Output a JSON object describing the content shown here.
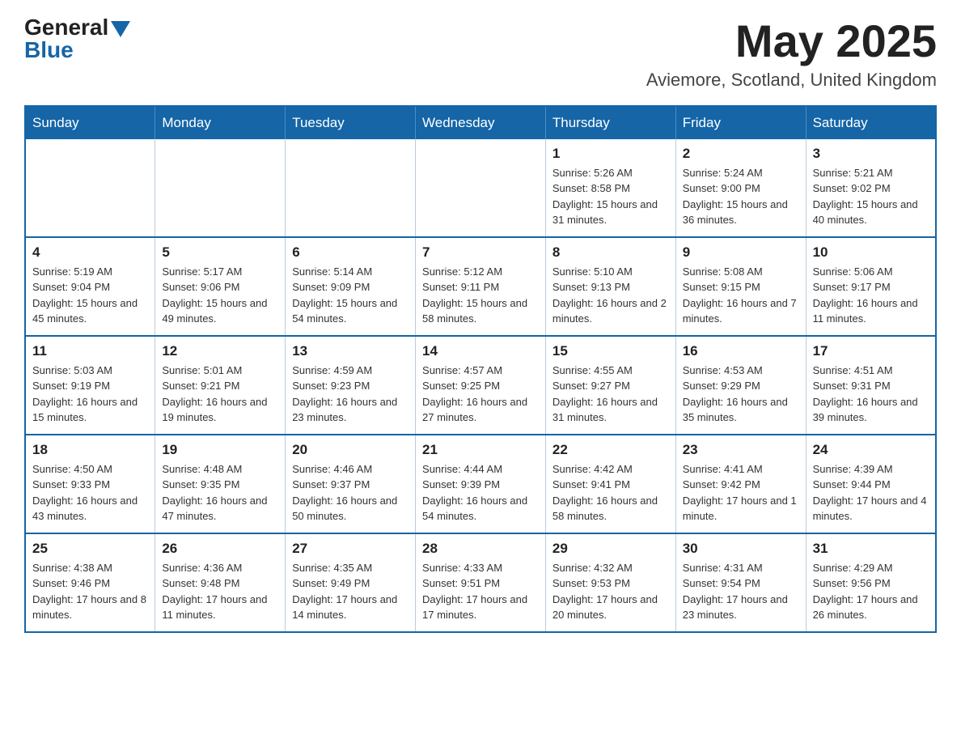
{
  "logo": {
    "general": "General",
    "blue": "Blue"
  },
  "title": {
    "month_year": "May 2025",
    "location": "Aviemore, Scotland, United Kingdom"
  },
  "weekdays": [
    "Sunday",
    "Monday",
    "Tuesday",
    "Wednesday",
    "Thursday",
    "Friday",
    "Saturday"
  ],
  "weeks": [
    [
      {
        "day": "",
        "info": ""
      },
      {
        "day": "",
        "info": ""
      },
      {
        "day": "",
        "info": ""
      },
      {
        "day": "",
        "info": ""
      },
      {
        "day": "1",
        "info": "Sunrise: 5:26 AM\nSunset: 8:58 PM\nDaylight: 15 hours and 31 minutes."
      },
      {
        "day": "2",
        "info": "Sunrise: 5:24 AM\nSunset: 9:00 PM\nDaylight: 15 hours and 36 minutes."
      },
      {
        "day": "3",
        "info": "Sunrise: 5:21 AM\nSunset: 9:02 PM\nDaylight: 15 hours and 40 minutes."
      }
    ],
    [
      {
        "day": "4",
        "info": "Sunrise: 5:19 AM\nSunset: 9:04 PM\nDaylight: 15 hours and 45 minutes."
      },
      {
        "day": "5",
        "info": "Sunrise: 5:17 AM\nSunset: 9:06 PM\nDaylight: 15 hours and 49 minutes."
      },
      {
        "day": "6",
        "info": "Sunrise: 5:14 AM\nSunset: 9:09 PM\nDaylight: 15 hours and 54 minutes."
      },
      {
        "day": "7",
        "info": "Sunrise: 5:12 AM\nSunset: 9:11 PM\nDaylight: 15 hours and 58 minutes."
      },
      {
        "day": "8",
        "info": "Sunrise: 5:10 AM\nSunset: 9:13 PM\nDaylight: 16 hours and 2 minutes."
      },
      {
        "day": "9",
        "info": "Sunrise: 5:08 AM\nSunset: 9:15 PM\nDaylight: 16 hours and 7 minutes."
      },
      {
        "day": "10",
        "info": "Sunrise: 5:06 AM\nSunset: 9:17 PM\nDaylight: 16 hours and 11 minutes."
      }
    ],
    [
      {
        "day": "11",
        "info": "Sunrise: 5:03 AM\nSunset: 9:19 PM\nDaylight: 16 hours and 15 minutes."
      },
      {
        "day": "12",
        "info": "Sunrise: 5:01 AM\nSunset: 9:21 PM\nDaylight: 16 hours and 19 minutes."
      },
      {
        "day": "13",
        "info": "Sunrise: 4:59 AM\nSunset: 9:23 PM\nDaylight: 16 hours and 23 minutes."
      },
      {
        "day": "14",
        "info": "Sunrise: 4:57 AM\nSunset: 9:25 PM\nDaylight: 16 hours and 27 minutes."
      },
      {
        "day": "15",
        "info": "Sunrise: 4:55 AM\nSunset: 9:27 PM\nDaylight: 16 hours and 31 minutes."
      },
      {
        "day": "16",
        "info": "Sunrise: 4:53 AM\nSunset: 9:29 PM\nDaylight: 16 hours and 35 minutes."
      },
      {
        "day": "17",
        "info": "Sunrise: 4:51 AM\nSunset: 9:31 PM\nDaylight: 16 hours and 39 minutes."
      }
    ],
    [
      {
        "day": "18",
        "info": "Sunrise: 4:50 AM\nSunset: 9:33 PM\nDaylight: 16 hours and 43 minutes."
      },
      {
        "day": "19",
        "info": "Sunrise: 4:48 AM\nSunset: 9:35 PM\nDaylight: 16 hours and 47 minutes."
      },
      {
        "day": "20",
        "info": "Sunrise: 4:46 AM\nSunset: 9:37 PM\nDaylight: 16 hours and 50 minutes."
      },
      {
        "day": "21",
        "info": "Sunrise: 4:44 AM\nSunset: 9:39 PM\nDaylight: 16 hours and 54 minutes."
      },
      {
        "day": "22",
        "info": "Sunrise: 4:42 AM\nSunset: 9:41 PM\nDaylight: 16 hours and 58 minutes."
      },
      {
        "day": "23",
        "info": "Sunrise: 4:41 AM\nSunset: 9:42 PM\nDaylight: 17 hours and 1 minute."
      },
      {
        "day": "24",
        "info": "Sunrise: 4:39 AM\nSunset: 9:44 PM\nDaylight: 17 hours and 4 minutes."
      }
    ],
    [
      {
        "day": "25",
        "info": "Sunrise: 4:38 AM\nSunset: 9:46 PM\nDaylight: 17 hours and 8 minutes."
      },
      {
        "day": "26",
        "info": "Sunrise: 4:36 AM\nSunset: 9:48 PM\nDaylight: 17 hours and 11 minutes."
      },
      {
        "day": "27",
        "info": "Sunrise: 4:35 AM\nSunset: 9:49 PM\nDaylight: 17 hours and 14 minutes."
      },
      {
        "day": "28",
        "info": "Sunrise: 4:33 AM\nSunset: 9:51 PM\nDaylight: 17 hours and 17 minutes."
      },
      {
        "day": "29",
        "info": "Sunrise: 4:32 AM\nSunset: 9:53 PM\nDaylight: 17 hours and 20 minutes."
      },
      {
        "day": "30",
        "info": "Sunrise: 4:31 AM\nSunset: 9:54 PM\nDaylight: 17 hours and 23 minutes."
      },
      {
        "day": "31",
        "info": "Sunrise: 4:29 AM\nSunset: 9:56 PM\nDaylight: 17 hours and 26 minutes."
      }
    ]
  ]
}
